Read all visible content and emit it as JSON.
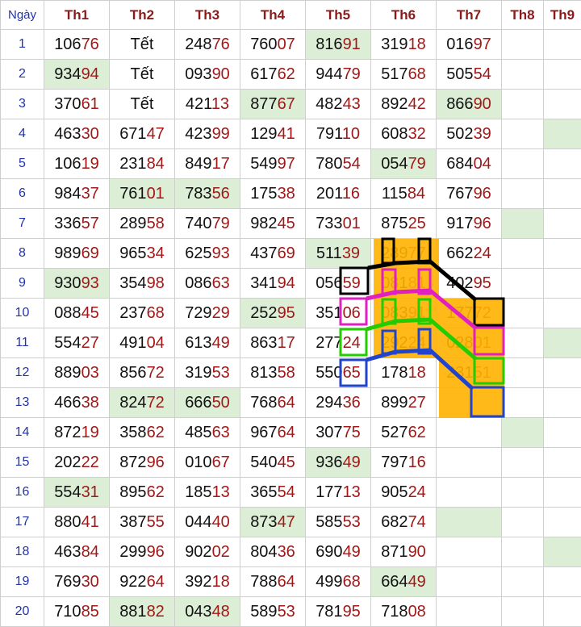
{
  "table": {
    "day_header": "Ngày",
    "columns": [
      "Th1",
      "Th2",
      "Th3",
      "Th4",
      "Th5",
      "Th6",
      "Th7",
      "Th8",
      "Th9"
    ],
    "rows": [
      {
        "day": "1",
        "cells": [
          {
            "h": "106",
            "t": "76"
          },
          {
            "text": "Tết"
          },
          {
            "h": "248",
            "t": "76"
          },
          {
            "h": "760",
            "t": "07"
          },
          {
            "h": "816",
            "t": "91",
            "hl": true
          },
          {
            "h": "319",
            "t": "18"
          },
          {
            "h": "016",
            "t": "97"
          },
          {},
          {}
        ]
      },
      {
        "day": "2",
        "cells": [
          {
            "h": "934",
            "t": "94",
            "hl": true
          },
          {
            "text": "Tết"
          },
          {
            "h": "093",
            "t": "90"
          },
          {
            "h": "617",
            "t": "62"
          },
          {
            "h": "944",
            "t": "79"
          },
          {
            "h": "517",
            "t": "68"
          },
          {
            "h": "505",
            "t": "54"
          },
          {},
          {}
        ]
      },
      {
        "day": "3",
        "cells": [
          {
            "h": "370",
            "t": "61"
          },
          {
            "text": "Tết"
          },
          {
            "h": "421",
            "t": "13"
          },
          {
            "h": "877",
            "t": "67",
            "hl": true
          },
          {
            "h": "482",
            "t": "43"
          },
          {
            "h": "892",
            "t": "42"
          },
          {
            "h": "866",
            "t": "90",
            "hl": true
          },
          {},
          {}
        ]
      },
      {
        "day": "4",
        "cells": [
          {
            "h": "463",
            "t": "30"
          },
          {
            "h": "671",
            "t": "47"
          },
          {
            "h": "423",
            "t": "99"
          },
          {
            "h": "129",
            "t": "41"
          },
          {
            "h": "791",
            "t": "10"
          },
          {
            "h": "608",
            "t": "32"
          },
          {
            "h": "502",
            "t": "39"
          },
          {},
          {
            "hl": true
          }
        ]
      },
      {
        "day": "5",
        "cells": [
          {
            "h": "106",
            "t": "19"
          },
          {
            "h": "231",
            "t": "84"
          },
          {
            "h": "849",
            "t": "17"
          },
          {
            "h": "549",
            "t": "97"
          },
          {
            "h": "780",
            "t": "54"
          },
          {
            "h": "054",
            "t": "79",
            "hl": true
          },
          {
            "h": "684",
            "t": "04"
          },
          {},
          {}
        ]
      },
      {
        "day": "6",
        "cells": [
          {
            "h": "984",
            "t": "37"
          },
          {
            "h": "761",
            "t": "01",
            "hl": true
          },
          {
            "h": "783",
            "t": "56",
            "hl": true
          },
          {
            "h": "175",
            "t": "38"
          },
          {
            "h": "201",
            "t": "16"
          },
          {
            "h": "115",
            "t": "84"
          },
          {
            "h": "767",
            "t": "96"
          },
          {},
          {}
        ]
      },
      {
        "day": "7",
        "cells": [
          {
            "h": "336",
            "t": "57"
          },
          {
            "h": "289",
            "t": "58"
          },
          {
            "h": "740",
            "t": "79"
          },
          {
            "h": "982",
            "t": "45"
          },
          {
            "h": "733",
            "t": "01"
          },
          {
            "h": "875",
            "t": "25"
          },
          {
            "h": "917",
            "t": "96"
          },
          {
            "hl": true
          },
          {}
        ]
      },
      {
        "day": "8",
        "cells": [
          {
            "h": "989",
            "t": "69"
          },
          {
            "h": "965",
            "t": "34"
          },
          {
            "h": "625",
            "t": "93"
          },
          {
            "h": "437",
            "t": "69"
          },
          {
            "h": "511",
            "t": "39",
            "hl": true
          },
          {
            "h": "289",
            "t": "77"
          },
          {
            "h": "662",
            "t": "24"
          },
          {},
          {}
        ]
      },
      {
        "day": "9",
        "cells": [
          {
            "h": "930",
            "t": "93",
            "hl": true
          },
          {
            "h": "354",
            "t": "98"
          },
          {
            "h": "086",
            "t": "63"
          },
          {
            "h": "341",
            "t": "94"
          },
          {
            "h": "056",
            "t": "59"
          },
          {
            "h": "081",
            "t": "81"
          },
          {
            "h": "402",
            "t": "95"
          },
          {},
          {}
        ]
      },
      {
        "day": "10",
        "cells": [
          {
            "h": "088",
            "t": "45"
          },
          {
            "h": "237",
            "t": "68"
          },
          {
            "h": "729",
            "t": "29"
          },
          {
            "h": "252",
            "t": "95",
            "hl": true
          },
          {
            "h": "351",
            "t": "06"
          },
          {
            "h": "083",
            "t": "91"
          },
          {
            "h": "177",
            "t": "72"
          },
          {},
          {}
        ]
      },
      {
        "day": "11",
        "cells": [
          {
            "h": "554",
            "t": "27"
          },
          {
            "h": "491",
            "t": "04"
          },
          {
            "h": "613",
            "t": "49"
          },
          {
            "h": "863",
            "t": "17"
          },
          {
            "h": "277",
            "t": "24"
          },
          {
            "h": "292",
            "t": "24"
          },
          {
            "h": "028",
            "t": "01"
          },
          {},
          {
            "hl": true
          }
        ]
      },
      {
        "day": "12",
        "cells": [
          {
            "h": "889",
            "t": "03"
          },
          {
            "h": "856",
            "t": "72"
          },
          {
            "h": "319",
            "t": "53"
          },
          {
            "h": "813",
            "t": "58"
          },
          {
            "h": "550",
            "t": "65"
          },
          {
            "h": "178",
            "t": "18"
          },
          {
            "h": "231",
            "t": "51"
          },
          {},
          {}
        ]
      },
      {
        "day": "13",
        "cells": [
          {
            "h": "466",
            "t": "38"
          },
          {
            "h": "824",
            "t": "72",
            "hl": true
          },
          {
            "h": "666",
            "t": "50",
            "hl": true
          },
          {
            "h": "768",
            "t": "64"
          },
          {
            "h": "294",
            "t": "36"
          },
          {
            "h": "899",
            "t": "27"
          },
          {},
          {},
          {}
        ]
      },
      {
        "day": "14",
        "cells": [
          {
            "h": "872",
            "t": "19"
          },
          {
            "h": "358",
            "t": "62"
          },
          {
            "h": "485",
            "t": "63"
          },
          {
            "h": "967",
            "t": "64"
          },
          {
            "h": "307",
            "t": "75"
          },
          {
            "h": "527",
            "t": "62"
          },
          {},
          {
            "hl": true
          },
          {}
        ]
      },
      {
        "day": "15",
        "cells": [
          {
            "h": "202",
            "t": "22"
          },
          {
            "h": "872",
            "t": "96"
          },
          {
            "h": "010",
            "t": "67"
          },
          {
            "h": "540",
            "t": "45"
          },
          {
            "h": "936",
            "t": "49",
            "hl": true
          },
          {
            "h": "797",
            "t": "16"
          },
          {},
          {},
          {}
        ]
      },
      {
        "day": "16",
        "cells": [
          {
            "h": "554",
            "t": "31",
            "hl": true
          },
          {
            "h": "895",
            "t": "62"
          },
          {
            "h": "185",
            "t": "13"
          },
          {
            "h": "365",
            "t": "54"
          },
          {
            "h": "177",
            "t": "13"
          },
          {
            "h": "905",
            "t": "24"
          },
          {},
          {},
          {}
        ]
      },
      {
        "day": "17",
        "cells": [
          {
            "h": "880",
            "t": "41"
          },
          {
            "h": "387",
            "t": "55"
          },
          {
            "h": "044",
            "t": "40"
          },
          {
            "h": "873",
            "t": "47",
            "hl": true
          },
          {
            "h": "585",
            "t": "53"
          },
          {
            "h": "682",
            "t": "74"
          },
          {
            "hl": true
          },
          {},
          {}
        ]
      },
      {
        "day": "18",
        "cells": [
          {
            "h": "463",
            "t": "84"
          },
          {
            "h": "299",
            "t": "96"
          },
          {
            "h": "902",
            "t": "02"
          },
          {
            "h": "804",
            "t": "36"
          },
          {
            "h": "690",
            "t": "49"
          },
          {
            "h": "871",
            "t": "90"
          },
          {},
          {},
          {
            "hl": true
          }
        ]
      },
      {
        "day": "19",
        "cells": [
          {
            "h": "769",
            "t": "30"
          },
          {
            "h": "922",
            "t": "64"
          },
          {
            "h": "392",
            "t": "18"
          },
          {
            "h": "788",
            "t": "64"
          },
          {
            "h": "499",
            "t": "68"
          },
          {
            "h": "664",
            "t": "49",
            "hl": true
          },
          {},
          {},
          {}
        ]
      },
      {
        "day": "20",
        "cells": [
          {
            "h": "710",
            "t": "85"
          },
          {
            "h": "881",
            "t": "82",
            "hl": true
          },
          {
            "h": "043",
            "t": "48",
            "hl": true
          },
          {
            "h": "589",
            "t": "53"
          },
          {
            "h": "781",
            "t": "95"
          },
          {
            "h": "718",
            "t": "08"
          },
          {},
          {},
          {}
        ]
      }
    ]
  },
  "annotations": {
    "colors": {
      "orange_fill": "#ffb300",
      "black": "#000000",
      "magenta": "#e020c0",
      "green": "#22cc00",
      "blue": "#2244cc"
    },
    "groups": [
      "black-pattern",
      "magenta-pattern",
      "green-pattern",
      "blue-pattern"
    ]
  }
}
